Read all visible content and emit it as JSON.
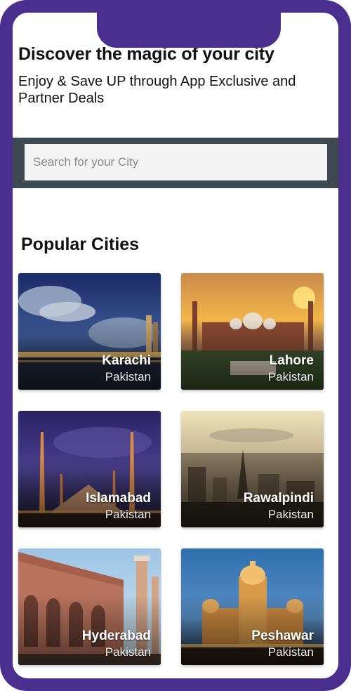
{
  "header": {
    "title": "Discover the magic of your city",
    "subtitle": "Enjoy & Save UP through App Exclusive and Partner Deals"
  },
  "search": {
    "placeholder": "Search for your City",
    "value": ""
  },
  "popular": {
    "title": "Popular Cities",
    "cities": [
      {
        "name": "Karachi",
        "country": "Pakistan"
      },
      {
        "name": "Lahore",
        "country": "Pakistan"
      },
      {
        "name": "Islamabad",
        "country": "Pakistan"
      },
      {
        "name": "Rawalpindi",
        "country": "Pakistan"
      },
      {
        "name": "Hyderabad",
        "country": "Pakistan"
      },
      {
        "name": "Peshawar",
        "country": "Pakistan"
      }
    ]
  },
  "colors": {
    "frame": "#4a2f8f",
    "search_bar": "#3d4a52"
  }
}
